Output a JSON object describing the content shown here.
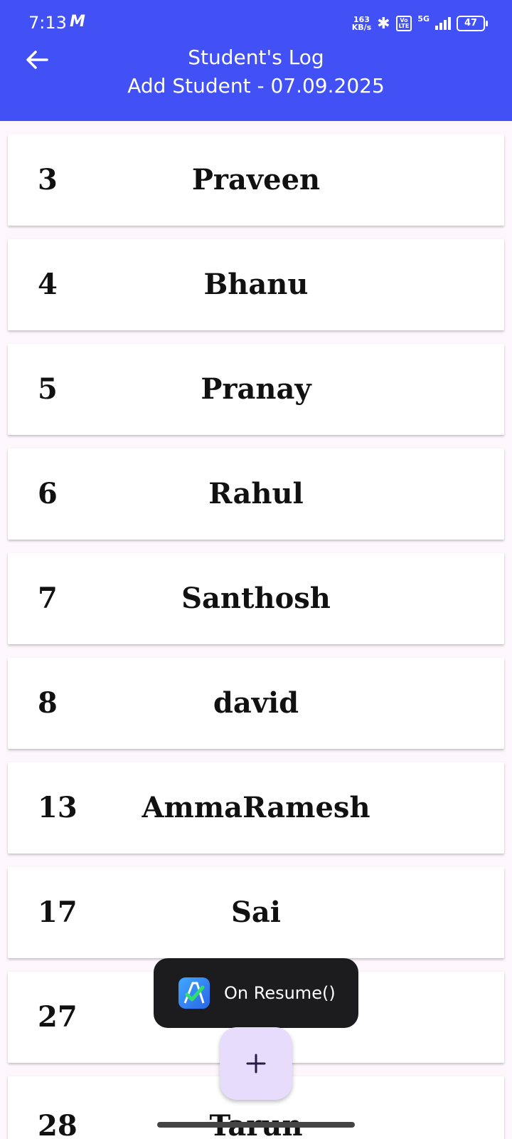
{
  "status_bar": {
    "time": "7:13",
    "notification_glyph": "M",
    "net_speed_value": "163",
    "net_speed_unit": "KB/s",
    "volte_top": "Vo",
    "volte_bottom": "LTE",
    "network": "5G",
    "battery": "47"
  },
  "header": {
    "title": "Student's Log",
    "subtitle": "Add Student - 07.09.2025",
    "back_icon": "arrow-left-icon",
    "background": "#4151f5"
  },
  "students": [
    {
      "num": "3",
      "name": "Praveen"
    },
    {
      "num": "4",
      "name": "Bhanu"
    },
    {
      "num": "5",
      "name": "Pranay"
    },
    {
      "num": "6",
      "name": "Rahul"
    },
    {
      "num": "7",
      "name": "Santhosh"
    },
    {
      "num": "8",
      "name": "david"
    },
    {
      "num": "13",
      "name": "AmmaRamesh"
    },
    {
      "num": "17",
      "name": "Sai"
    },
    {
      "num": "27",
      "name": ""
    },
    {
      "num": "28",
      "name": "Tarun"
    }
  ],
  "toast": {
    "text": "On Resume()",
    "icon": "app-logo-icon"
  },
  "fab": {
    "icon": "plus-icon",
    "color": "#e7dcfb"
  }
}
